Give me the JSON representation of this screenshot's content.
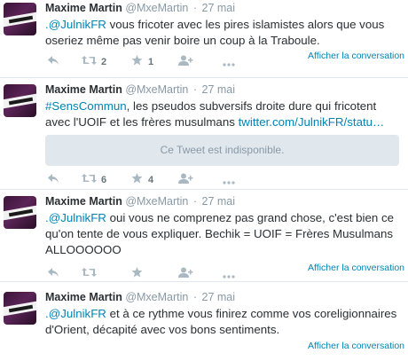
{
  "tweets": [
    {
      "name": "Maxime Martin",
      "handle": "@MxeMartin",
      "time": "27 mai",
      "mention": ".@JulnikFR",
      "text": " vous fricoter avec les pires islamistes alors que vous oseriez même pas venir boire un coup à la Traboule.",
      "retweets": "2",
      "favorites": "1",
      "conversation": "Afficher la conversation"
    },
    {
      "name": "Maxime Martin",
      "handle": "@MxeMartin",
      "time": "27 mai",
      "hashtag": "#SensCommun",
      "text": ", les pseudos subversifs droite dure qui fricotent avec l'UOIF et les frères musulmans ",
      "link": "twitter.com/JulnikFR/statu…",
      "card": "Ce Tweet est indisponible.",
      "retweets": "6",
      "favorites": "4"
    },
    {
      "name": "Maxime Martin",
      "handle": "@MxeMartin",
      "time": "27 mai",
      "mention": ".@JulnikFR",
      "text": " oui vous ne comprenez pas grand chose, c'est bien ce qu'on tente de vous expliquer. Bechik = UOIF = Frères Musulmans ALLOOOOOO",
      "retweets": "",
      "favorites": "",
      "conversation": "Afficher la conversation"
    },
    {
      "name": "Maxime Martin",
      "handle": "@MxeMartin",
      "time": "27 mai",
      "mention": ".@JulnikFR",
      "text": " et à ce rythme vous finirez comme vos coreligionnaires d'Orient, décapité avec vos bons sentiments.",
      "conversation": "Afficher la conversation"
    }
  ],
  "icons": {
    "reply": "reply-icon",
    "retweet": "retweet-icon",
    "favorite": "star-icon",
    "follow": "follow-icon",
    "more": "more-icon"
  },
  "colors": {
    "link": "#0084b4",
    "muted": "#8899a6",
    "action": "#aab8c2",
    "avatar": "#4a1d47"
  }
}
